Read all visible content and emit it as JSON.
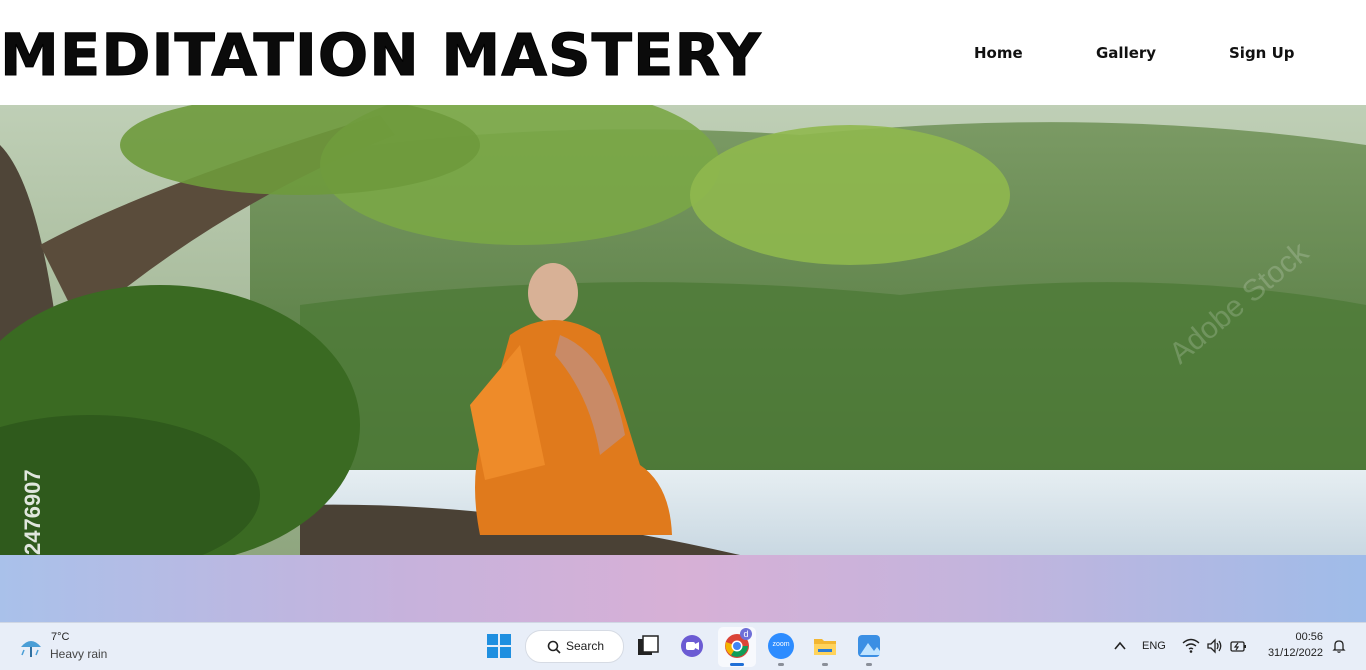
{
  "header": {
    "title": "MEDITATION MASTERY",
    "nav": [
      "Home",
      "Gallery",
      "Sign Up"
    ]
  },
  "hero": {
    "watermark_number": "2476907",
    "watermark_text": "Adobe Stock"
  },
  "taskbar": {
    "weather_temp": "7°C",
    "weather_desc": "Heavy rain",
    "search_label": "Search",
    "language": "ENG",
    "time": "00:56",
    "date": "31/12/2022",
    "chrome_badge": "d",
    "zoom_label": "zoom"
  },
  "colors": {
    "robe": "#e07a1c",
    "water": "#d9e6ee",
    "band_left": "#a9c1ea",
    "band_mid": "#d7b0d6"
  }
}
